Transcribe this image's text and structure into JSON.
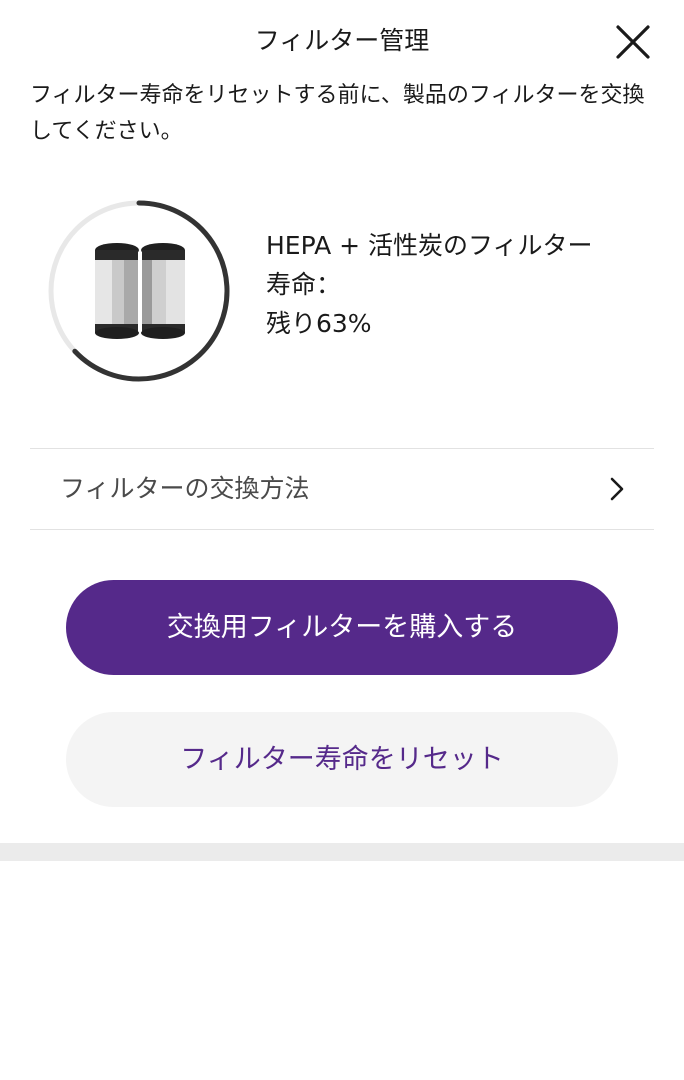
{
  "header": {
    "title": "フィルター管理",
    "close_icon": "close-icon"
  },
  "instruction": "フィルター寿命をリセットする前に、製品のフィルターを交換してください。",
  "filter": {
    "name": "HEPA + 活性炭のフィルター寿命：",
    "life_label": "残り63%",
    "remaining_fraction": 0.63,
    "image_icon": "cylindrical-filter-image"
  },
  "how_to": {
    "label": "フィルターの交換方法",
    "icon": "chevron-right-icon"
  },
  "actions": {
    "buy_label": "交換用フィルターを購入する",
    "reset_label": "フィルター寿命をリセット"
  },
  "colors": {
    "accent": "#55298a",
    "gauge_track": "#e8e8e8",
    "gauge_fill": "#333333",
    "secondary_bg": "#f4f4f4"
  }
}
